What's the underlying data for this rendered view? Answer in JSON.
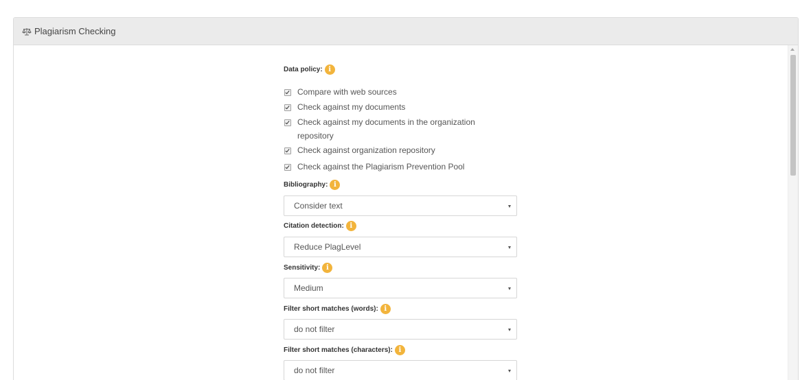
{
  "panel": {
    "title": "Plagiarism Checking",
    "title_icon": "balance-scale-icon"
  },
  "info_icon_glyph": "i",
  "data_policy": {
    "label": "Data policy:",
    "options": [
      {
        "label": "Compare with web sources",
        "checked": true
      },
      {
        "label": "Check against my documents",
        "checked": true
      },
      {
        "label": "Check against my documents in the organization repository",
        "checked": true
      },
      {
        "label": "Check against organization repository",
        "checked": true
      },
      {
        "label": "Check against the Plagiarism Prevention Pool",
        "checked": true
      }
    ]
  },
  "bibliography": {
    "label": "Bibliography:",
    "value": "Consider text"
  },
  "citation_detection": {
    "label": "Citation detection:",
    "value": "Reduce PlagLevel"
  },
  "sensitivity": {
    "label": "Sensitivity:",
    "value": "Medium"
  },
  "filter_words": {
    "label": "Filter short matches (words):",
    "value": "do not filter"
  },
  "filter_characters": {
    "label": "Filter short matches (characters):",
    "value": "do not filter"
  },
  "colors": {
    "info_icon": "#f2b43c",
    "heading_bg": "#ebebeb",
    "border": "#dcdcdc"
  }
}
